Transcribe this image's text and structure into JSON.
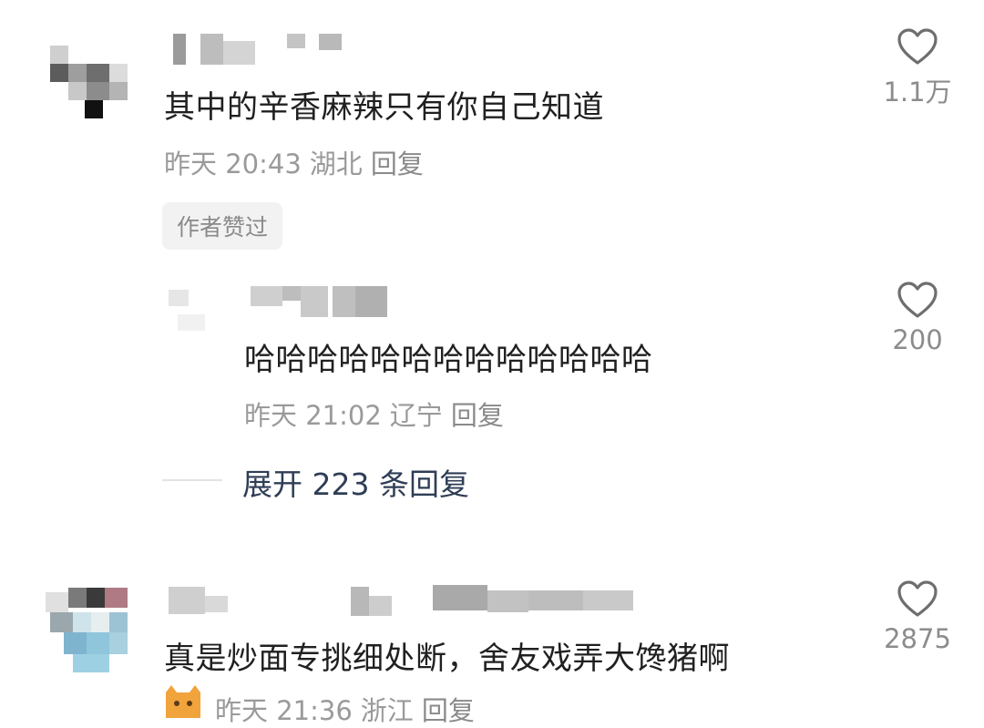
{
  "comments": [
    {
      "text": "其中的辛香麻辣只有你自己知道",
      "time": "昨天 20:43",
      "location": "湖北",
      "reply_label": "回复",
      "likes": "1.1万",
      "badge": "作者赞过"
    },
    {
      "text": "真是炒面专挑细处断，舍友戏弄大馋猪啊",
      "time": "昨天 21:36",
      "location": "浙江",
      "reply_label": "回复",
      "likes": "2875"
    }
  ],
  "reply": {
    "text": "哈哈哈哈哈哈哈哈哈哈哈哈哈",
    "time": "昨天 21:02",
    "location": "辽宁",
    "reply_label": "回复",
    "likes": "200"
  },
  "expand_label": "展开 223 条回复",
  "colors": {
    "text": "#202020",
    "meta": "#9a9a9a",
    "expand": "#2f3e56",
    "badge_bg": "#f2f2f2"
  }
}
